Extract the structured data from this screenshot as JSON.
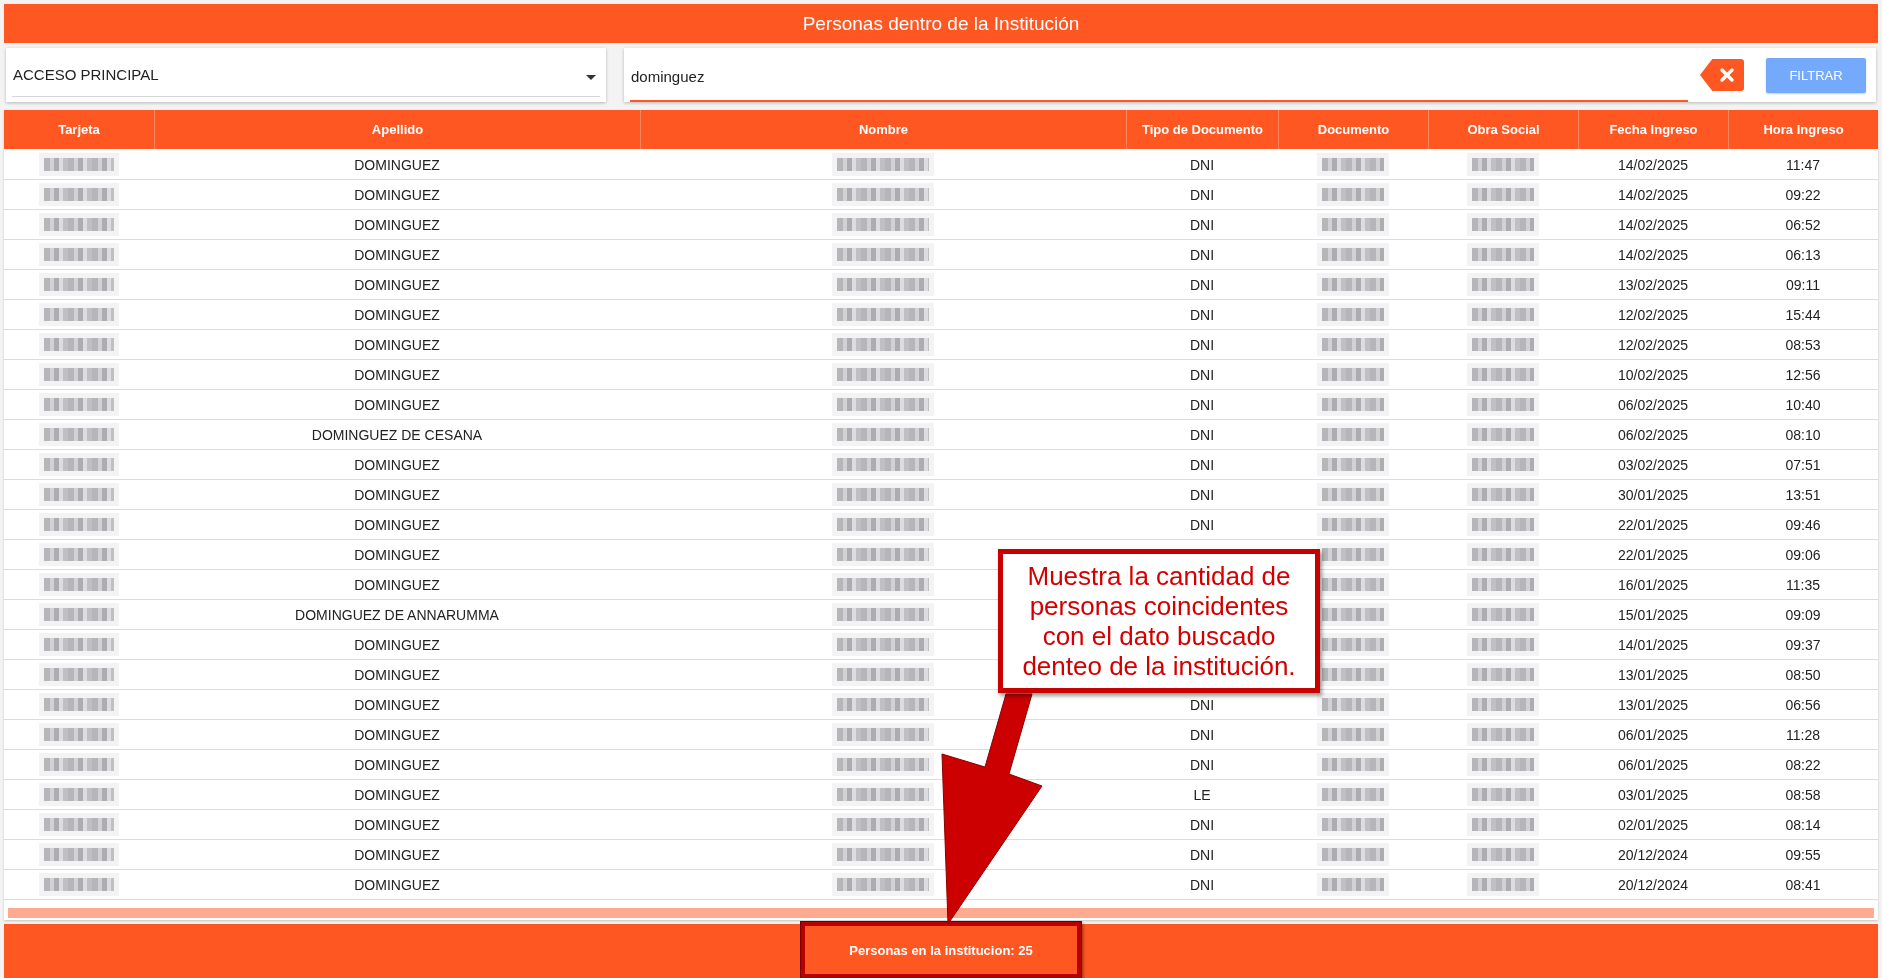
{
  "window": {
    "title": "Personas dentro de la Institución"
  },
  "filters": {
    "access_select": {
      "value": "ACCESO PRINCIPAL"
    },
    "search": {
      "value": "dominguez"
    },
    "filter_button": {
      "label": "FILTRAR"
    }
  },
  "table": {
    "columns": [
      {
        "label": "Tarjeta",
        "redacted": true
      },
      {
        "label": "Apellido",
        "redacted": false
      },
      {
        "label": "Nombre",
        "redacted": true
      },
      {
        "label": "Tipo de Documento",
        "redacted": false
      },
      {
        "label": "Documento",
        "redacted": true
      },
      {
        "label": "Obra Social",
        "redacted": true
      },
      {
        "label": "Fecha Ingreso",
        "redacted": false
      },
      {
        "label": "Hora Ingreso",
        "redacted": false
      }
    ],
    "rows": [
      {
        "apellido": "DOMINGUEZ",
        "tipo_documento": "DNI",
        "fecha_ingreso": "14/02/2025",
        "hora_ingreso": "11:47"
      },
      {
        "apellido": "DOMINGUEZ",
        "tipo_documento": "DNI",
        "fecha_ingreso": "14/02/2025",
        "hora_ingreso": "09:22"
      },
      {
        "apellido": "DOMINGUEZ",
        "tipo_documento": "DNI",
        "fecha_ingreso": "14/02/2025",
        "hora_ingreso": "06:52"
      },
      {
        "apellido": "DOMINGUEZ",
        "tipo_documento": "DNI",
        "fecha_ingreso": "14/02/2025",
        "hora_ingreso": "06:13"
      },
      {
        "apellido": "DOMINGUEZ",
        "tipo_documento": "DNI",
        "fecha_ingreso": "13/02/2025",
        "hora_ingreso": "09:11"
      },
      {
        "apellido": "DOMINGUEZ",
        "tipo_documento": "DNI",
        "fecha_ingreso": "12/02/2025",
        "hora_ingreso": "15:44"
      },
      {
        "apellido": "DOMINGUEZ",
        "tipo_documento": "DNI",
        "fecha_ingreso": "12/02/2025",
        "hora_ingreso": "08:53"
      },
      {
        "apellido": "DOMINGUEZ",
        "tipo_documento": "DNI",
        "fecha_ingreso": "10/02/2025",
        "hora_ingreso": "12:56"
      },
      {
        "apellido": "DOMINGUEZ",
        "tipo_documento": "DNI",
        "fecha_ingreso": "06/02/2025",
        "hora_ingreso": "10:40"
      },
      {
        "apellido": "DOMINGUEZ DE CESANA",
        "tipo_documento": "DNI",
        "fecha_ingreso": "06/02/2025",
        "hora_ingreso": "08:10"
      },
      {
        "apellido": "DOMINGUEZ",
        "tipo_documento": "DNI",
        "fecha_ingreso": "03/02/2025",
        "hora_ingreso": "07:51"
      },
      {
        "apellido": "DOMINGUEZ",
        "tipo_documento": "DNI",
        "fecha_ingreso": "30/01/2025",
        "hora_ingreso": "13:51"
      },
      {
        "apellido": "DOMINGUEZ",
        "tipo_documento": "DNI",
        "fecha_ingreso": "22/01/2025",
        "hora_ingreso": "09:46"
      },
      {
        "apellido": "DOMINGUEZ",
        "fecha_ingreso": "22/01/2025",
        "hora_ingreso": "09:06"
      },
      {
        "apellido": "DOMINGUEZ",
        "fecha_ingreso": "16/01/2025",
        "hora_ingreso": "11:35"
      },
      {
        "apellido": "DOMINGUEZ DE ANNARUMMA",
        "fecha_ingreso": "15/01/2025",
        "hora_ingreso": "09:09"
      },
      {
        "apellido": "DOMINGUEZ",
        "fecha_ingreso": "14/01/2025",
        "hora_ingreso": "09:37"
      },
      {
        "apellido": "DOMINGUEZ",
        "fecha_ingreso": "13/01/2025",
        "hora_ingreso": "08:50"
      },
      {
        "apellido": "DOMINGUEZ",
        "tipo_documento": "DNI",
        "fecha_ingreso": "13/01/2025",
        "hora_ingreso": "06:56"
      },
      {
        "apellido": "DOMINGUEZ",
        "tipo_documento": "DNI",
        "fecha_ingreso": "06/01/2025",
        "hora_ingreso": "11:28"
      },
      {
        "apellido": "DOMINGUEZ",
        "tipo_documento": "DNI",
        "fecha_ingreso": "06/01/2025",
        "hora_ingreso": "08:22"
      },
      {
        "apellido": "DOMINGUEZ",
        "tipo_documento": "LE",
        "fecha_ingreso": "03/01/2025",
        "hora_ingreso": "08:58"
      },
      {
        "apellido": "DOMINGUEZ",
        "tipo_documento": "DNI",
        "fecha_ingreso": "02/01/2025",
        "hora_ingreso": "08:14"
      },
      {
        "apellido": "DOMINGUEZ",
        "tipo_documento": "DNI",
        "fecha_ingreso": "20/12/2024",
        "hora_ingreso": "09:55"
      },
      {
        "apellido": "DOMINGUEZ",
        "tipo_documento": "DNI",
        "fecha_ingreso": "20/12/2024",
        "hora_ingreso": "08:41"
      }
    ]
  },
  "callout": {
    "text": "Muestra la cantidad de personas coincidentes con el dato buscado denteo de la institución."
  },
  "footer": {
    "count_label": "Personas en la institucion: 25",
    "highlighted": true
  }
}
